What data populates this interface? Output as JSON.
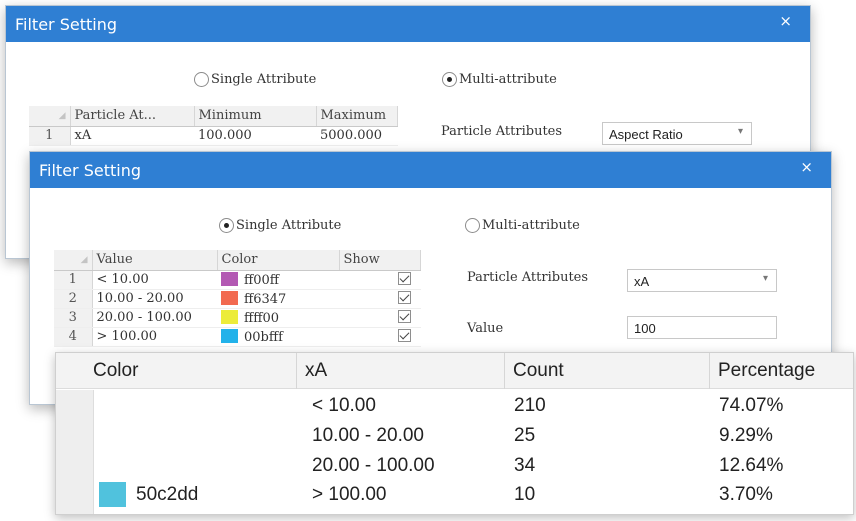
{
  "back_dialog": {
    "title": "Filter Setting",
    "close": "×",
    "radio_single": "Single Attribute",
    "radio_multi": "Multi-attribute",
    "grid": {
      "columns": [
        "Particle At...",
        "Minimum",
        "Maximum"
      ],
      "rows": [
        {
          "num": "1",
          "attr": "xA",
          "min": "100.000",
          "max": "5000.000"
        }
      ]
    },
    "attr_label": "Particle Attributes",
    "attr_value": "Aspect Ratio"
  },
  "front_dialog": {
    "title": "Filter Setting",
    "close": "×",
    "radio_single": "Single Attribute",
    "radio_multi": "Multi-attribute",
    "grid": {
      "columns": [
        "Value",
        "Color",
        "Show"
      ],
      "rows": [
        {
          "num": "1",
          "value": "< 10.00",
          "hex": "ff00ff",
          "swatch": "#b359b3",
          "show": true
        },
        {
          "num": "2",
          "value": "10.00 - 20.00",
          "hex": "ff6347",
          "swatch": "#f26a50",
          "show": true
        },
        {
          "num": "3",
          "value": "20.00 - 100.00",
          "hex": "ffff00",
          "swatch": "#ecec3a",
          "show": true
        },
        {
          "num": "4",
          "value": "> 100.00",
          "hex": "00bfff",
          "swatch": "#22b2ea",
          "show": true
        }
      ]
    },
    "attr_label": "Particle Attributes",
    "attr_value": "xA",
    "value_label": "Value",
    "value_input": "100"
  },
  "results": {
    "columns": [
      "Color",
      "xA",
      "Count",
      "Percentage"
    ],
    "rows": [
      {
        "color": "",
        "xa": "< 10.00",
        "count": "210",
        "percentage": "74.07%"
      },
      {
        "color": "",
        "xa": "10.00 - 20.00",
        "count": "25",
        "percentage": "9.29%"
      },
      {
        "color": "",
        "xa": "20.00 - 100.00",
        "count": "34",
        "percentage": "12.64%"
      },
      {
        "color": "50c2dd",
        "xa": "> 100.00",
        "count": "10",
        "percentage": "3.70%"
      }
    ],
    "swatch_color": "#50c2dd"
  }
}
